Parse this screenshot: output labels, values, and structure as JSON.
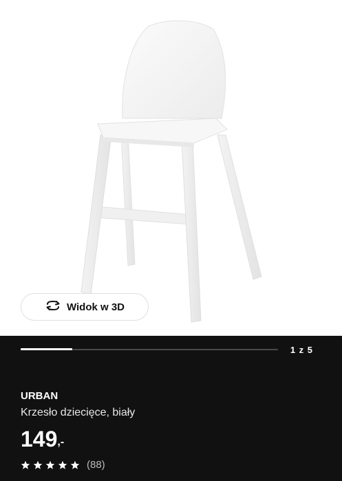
{
  "product_image": {
    "view3d_label": "Widok w 3D",
    "icon": "rotate-3d-icon"
  },
  "carousel": {
    "counter": "1 z 5",
    "progress": 0.2
  },
  "product": {
    "name": "URBAN",
    "description": "Krzesło dziecięce, biały",
    "price_integer": "149",
    "price_suffix": ",-",
    "rating_stars": 5,
    "review_count": "(88)"
  },
  "colors": {
    "background_dark": "#111111",
    "text": "#ffffff",
    "muted": "#bdbdbd"
  }
}
